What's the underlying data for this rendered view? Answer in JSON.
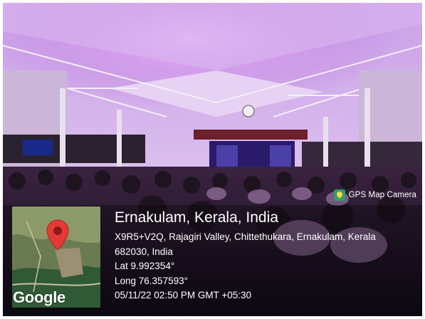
{
  "badge": {
    "icon": "map-pin-camera-icon",
    "label": "GPS Map Camera"
  },
  "map": {
    "provider_logo": "Google",
    "pin_icon": "location-pin-icon"
  },
  "location": {
    "title": "Ernakulam, Kerala, India",
    "address_line1": "X9R5+V2Q, Rajagiri Valley, Chittethukara, Ernakulam, Kerala",
    "address_line2": "682030, India",
    "lat": "Lat 9.992354°",
    "long": "Long 76.357593°",
    "datetime": "05/11/22 02:50 PM GMT +05:30"
  },
  "colors": {
    "lighting": "#b060d8",
    "pin": "#e53935",
    "badge": "#2f9e6f"
  }
}
